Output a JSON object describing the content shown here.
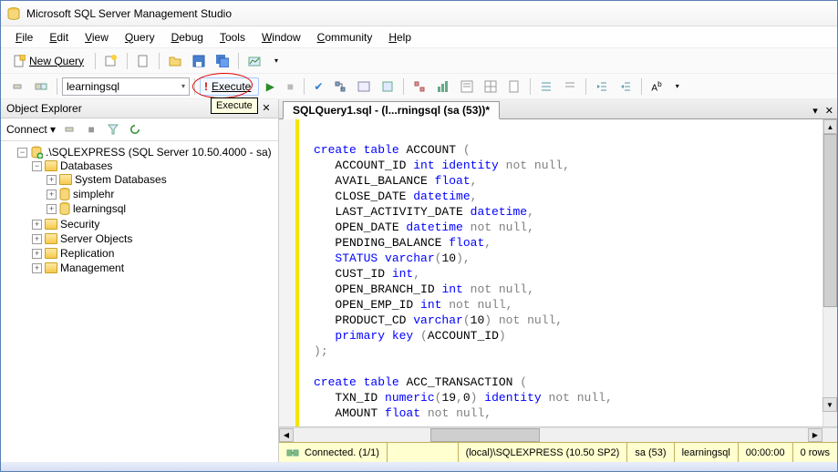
{
  "title": "Microsoft SQL Server Management Studio",
  "menu": {
    "file": "File",
    "edit": "Edit",
    "view": "View",
    "query": "Query",
    "debug": "Debug",
    "tools": "Tools",
    "window": "Window",
    "community": "Community",
    "help": "Help"
  },
  "toolbar1": {
    "new_query": "New Query"
  },
  "toolbar2": {
    "database": "learningsql",
    "execute": "Execute",
    "tooltip": "Execute"
  },
  "object_explorer": {
    "title": "Object Explorer",
    "connect": "Connect",
    "root": ".\\SQLEXPRESS (SQL Server 10.50.4000 - sa)",
    "nodes": {
      "databases": "Databases",
      "system_databases": "System Databases",
      "simplehr": "simplehr",
      "learningsql": "learningsql",
      "security": "Security",
      "server_objects": "Server Objects",
      "replication": "Replication",
      "management": "Management"
    }
  },
  "editor": {
    "tab_title": "SQLQuery1.sql - (l...rningsql (sa (53))*",
    "code_tokens": [
      [
        "",
        "\n"
      ],
      [
        "kw",
        "create"
      ],
      [
        "",
        " "
      ],
      [
        "kw",
        "table"
      ],
      [
        "",
        " ACCOUNT "
      ],
      [
        "paren",
        "("
      ],
      [
        "",
        "\n"
      ],
      [
        "",
        "   ACCOUNT_ID "
      ],
      [
        "kw",
        "int"
      ],
      [
        "",
        " "
      ],
      [
        "kw",
        "identity"
      ],
      [
        "",
        " "
      ],
      [
        "gray",
        "not"
      ],
      [
        "",
        " "
      ],
      [
        "gray",
        "null,"
      ],
      [
        "",
        "\n"
      ],
      [
        "",
        "   AVAIL_BALANCE "
      ],
      [
        "kw",
        "float"
      ],
      [
        "gray",
        ","
      ],
      [
        "",
        "\n"
      ],
      [
        "",
        "   CLOSE_DATE "
      ],
      [
        "kw",
        "datetime"
      ],
      [
        "gray",
        ","
      ],
      [
        "",
        "\n"
      ],
      [
        "",
        "   LAST_ACTIVITY_DATE "
      ],
      [
        "kw",
        "datetime"
      ],
      [
        "gray",
        ","
      ],
      [
        "",
        "\n"
      ],
      [
        "",
        "   OPEN_DATE "
      ],
      [
        "kw",
        "datetime"
      ],
      [
        "",
        " "
      ],
      [
        "gray",
        "not"
      ],
      [
        "",
        " "
      ],
      [
        "gray",
        "null,"
      ],
      [
        "",
        "\n"
      ],
      [
        "",
        "   PENDING_BALANCE "
      ],
      [
        "kw",
        "float"
      ],
      [
        "gray",
        ","
      ],
      [
        "",
        "\n"
      ],
      [
        "",
        "   "
      ],
      [
        "kw",
        "STATUS"
      ],
      [
        "",
        " "
      ],
      [
        "kw",
        "varchar"
      ],
      [
        "paren",
        "("
      ],
      [
        "",
        "10"
      ],
      [
        "paren",
        ")"
      ],
      [
        "gray",
        ","
      ],
      [
        "",
        "\n"
      ],
      [
        "",
        "   CUST_ID "
      ],
      [
        "kw",
        "int"
      ],
      [
        "gray",
        ","
      ],
      [
        "",
        "\n"
      ],
      [
        "",
        "   OPEN_BRANCH_ID "
      ],
      [
        "kw",
        "int"
      ],
      [
        "",
        " "
      ],
      [
        "gray",
        "not"
      ],
      [
        "",
        " "
      ],
      [
        "gray",
        "null,"
      ],
      [
        "",
        "\n"
      ],
      [
        "",
        "   OPEN_EMP_ID "
      ],
      [
        "kw",
        "int"
      ],
      [
        "",
        " "
      ],
      [
        "gray",
        "not"
      ],
      [
        "",
        " "
      ],
      [
        "gray",
        "null,"
      ],
      [
        "",
        "\n"
      ],
      [
        "",
        "   PRODUCT_CD "
      ],
      [
        "kw",
        "varchar"
      ],
      [
        "paren",
        "("
      ],
      [
        "",
        "10"
      ],
      [
        "paren",
        ")"
      ],
      [
        "",
        " "
      ],
      [
        "gray",
        "not"
      ],
      [
        "",
        " "
      ],
      [
        "gray",
        "null,"
      ],
      [
        "",
        "\n"
      ],
      [
        "",
        "   "
      ],
      [
        "kw",
        "primary"
      ],
      [
        "",
        " "
      ],
      [
        "kw",
        "key"
      ],
      [
        "",
        " "
      ],
      [
        "paren",
        "("
      ],
      [
        "",
        "ACCOUNT_ID"
      ],
      [
        "paren",
        ")"
      ],
      [
        "",
        "\n"
      ],
      [
        "paren",
        ")"
      ],
      [
        "gray",
        ";"
      ],
      [
        "",
        "\n"
      ],
      [
        "",
        "\n"
      ],
      [
        "kw",
        "create"
      ],
      [
        "",
        " "
      ],
      [
        "kw",
        "table"
      ],
      [
        "",
        " ACC_TRANSACTION "
      ],
      [
        "paren",
        "("
      ],
      [
        "",
        "\n"
      ],
      [
        "",
        "   TXN_ID "
      ],
      [
        "kw",
        "numeric"
      ],
      [
        "paren",
        "("
      ],
      [
        "",
        "19"
      ],
      [
        "gray",
        ","
      ],
      [
        "",
        "0"
      ],
      [
        "paren",
        ")"
      ],
      [
        "",
        " "
      ],
      [
        "kw",
        "identity"
      ],
      [
        "",
        " "
      ],
      [
        "gray",
        "not"
      ],
      [
        "",
        " "
      ],
      [
        "gray",
        "null,"
      ],
      [
        "",
        "\n"
      ],
      [
        "",
        "   AMOUNT "
      ],
      [
        "kw",
        "float"
      ],
      [
        "",
        " "
      ],
      [
        "gray",
        "not"
      ],
      [
        "",
        " "
      ],
      [
        "gray",
        "null,"
      ],
      [
        "",
        "\n"
      ]
    ]
  },
  "status": {
    "connection": "Connected. (1/1)",
    "server": "(local)\\SQLEXPRESS (10.50 SP2)",
    "user": "sa (53)",
    "db": "learningsql",
    "time": "00:00:00",
    "rows": "0 rows"
  }
}
